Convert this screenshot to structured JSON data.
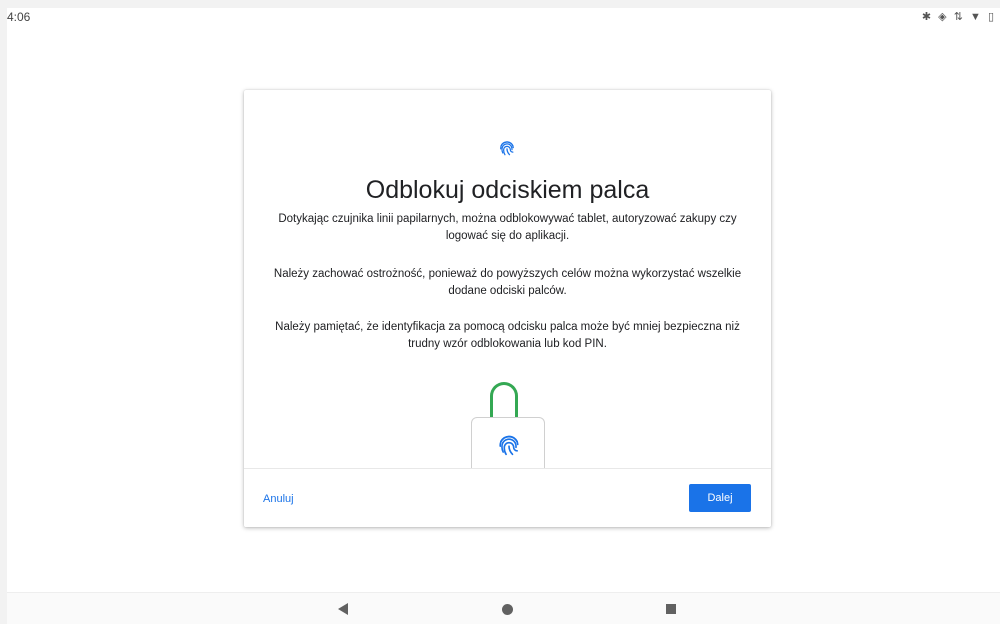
{
  "status_bar": {
    "time": "4:06",
    "icons": [
      "bluetooth-icon",
      "vibrate-icon",
      "data-icon",
      "wifi-icon",
      "battery-icon"
    ]
  },
  "dialog": {
    "header_icon": "fingerprint-icon",
    "title": "Odblokuj odciskiem palca",
    "paragraph1": "Dotykając czujnika linii papilarnych, można odblokowywać tablet, autoryzować zakupy czy logować się do aplikacji.",
    "paragraph2": "Należy zachować ostrożność, ponieważ do powyższych celów można wykorzystać wszelkie dodane odciski palców.",
    "paragraph3": "Należy pamiętać, że identyfikacja za pomocą odcisku palca może być mniej bezpieczna niż trudny wzór odblokowania lub kod PIN.",
    "illustration": "unlocked-padlock-fingerprint",
    "cancel_label": "Anuluj",
    "next_label": "Dalej"
  },
  "navigation_bar": {
    "buttons": [
      "back-icon",
      "home-icon",
      "recents-icon"
    ]
  },
  "colors": {
    "accent": "#1a73e8",
    "lock_shackle": "#34a853"
  }
}
